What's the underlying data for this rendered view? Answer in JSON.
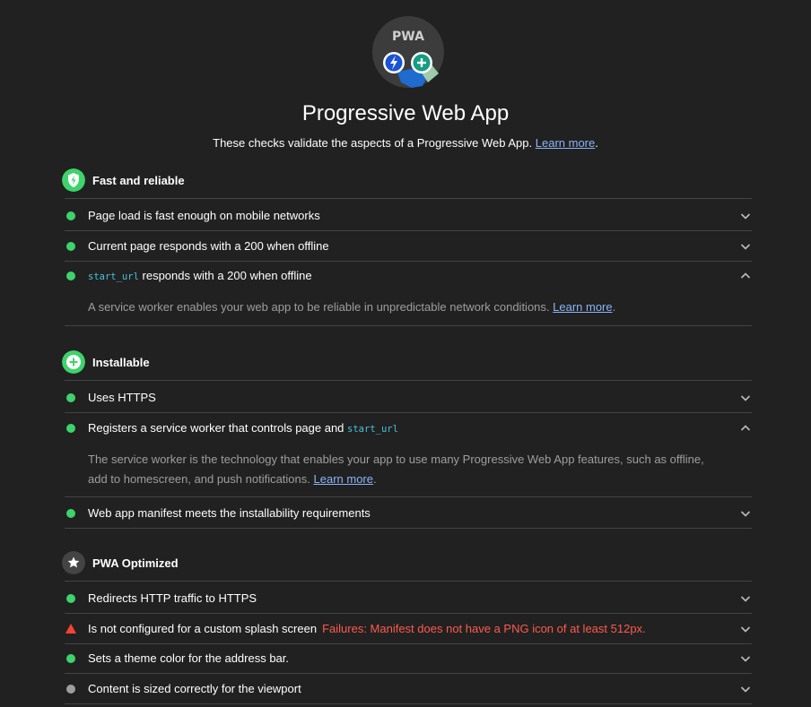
{
  "header": {
    "badge_label": "PWA",
    "title": "Progressive Web App",
    "description": "These checks validate the aspects of a Progressive Web App.",
    "learn_more": "Learn more",
    "period": "."
  },
  "groups": {
    "fast": {
      "title": "Fast and reliable",
      "audits": [
        {
          "title": "Page load is fast enough on mobile networks"
        },
        {
          "title": "Current page responds with a 200 when offline"
        },
        {
          "code": "start_url",
          "title": " responds with a 200 when offline",
          "description": "A service worker enables your web app to be reliable in unpredictable network conditions.",
          "learn_more": "Learn more",
          "period": "."
        }
      ]
    },
    "installable": {
      "title": "Installable",
      "audits": [
        {
          "title": "Uses HTTPS"
        },
        {
          "title": "Registers a service worker that controls page and ",
          "code": "start_url",
          "description": "The service worker is the technology that enables your app to use many Progressive Web App features, such as offline, add to homescreen, and push notifications.",
          "learn_more": "Learn more",
          "period": "."
        },
        {
          "title": "Web app manifest meets the installability requirements"
        }
      ]
    },
    "optimized": {
      "title": "PWA Optimized",
      "audits": [
        {
          "title": "Redirects HTTP traffic to HTTPS"
        },
        {
          "title": "Is not configured for a custom splash screen",
          "failure": "Failures: Manifest does not have a PNG icon of at least 512px."
        },
        {
          "title": "Sets a theme color for the address bar."
        },
        {
          "title": "Content is sized correctly for the viewport"
        }
      ]
    }
  },
  "colors": {
    "background": "#212121",
    "pass": "#3ed36b",
    "fail": "#f44336",
    "info": "#9e9e9e",
    "link": "#8ab4f8",
    "code": "#4ac1d6"
  },
  "icons": {
    "fast": "bolt-shield-icon",
    "installable": "plus-circle-icon",
    "optimized": "star-icon",
    "collapsed": "chevron-down-icon",
    "expanded": "chevron-up-icon"
  }
}
